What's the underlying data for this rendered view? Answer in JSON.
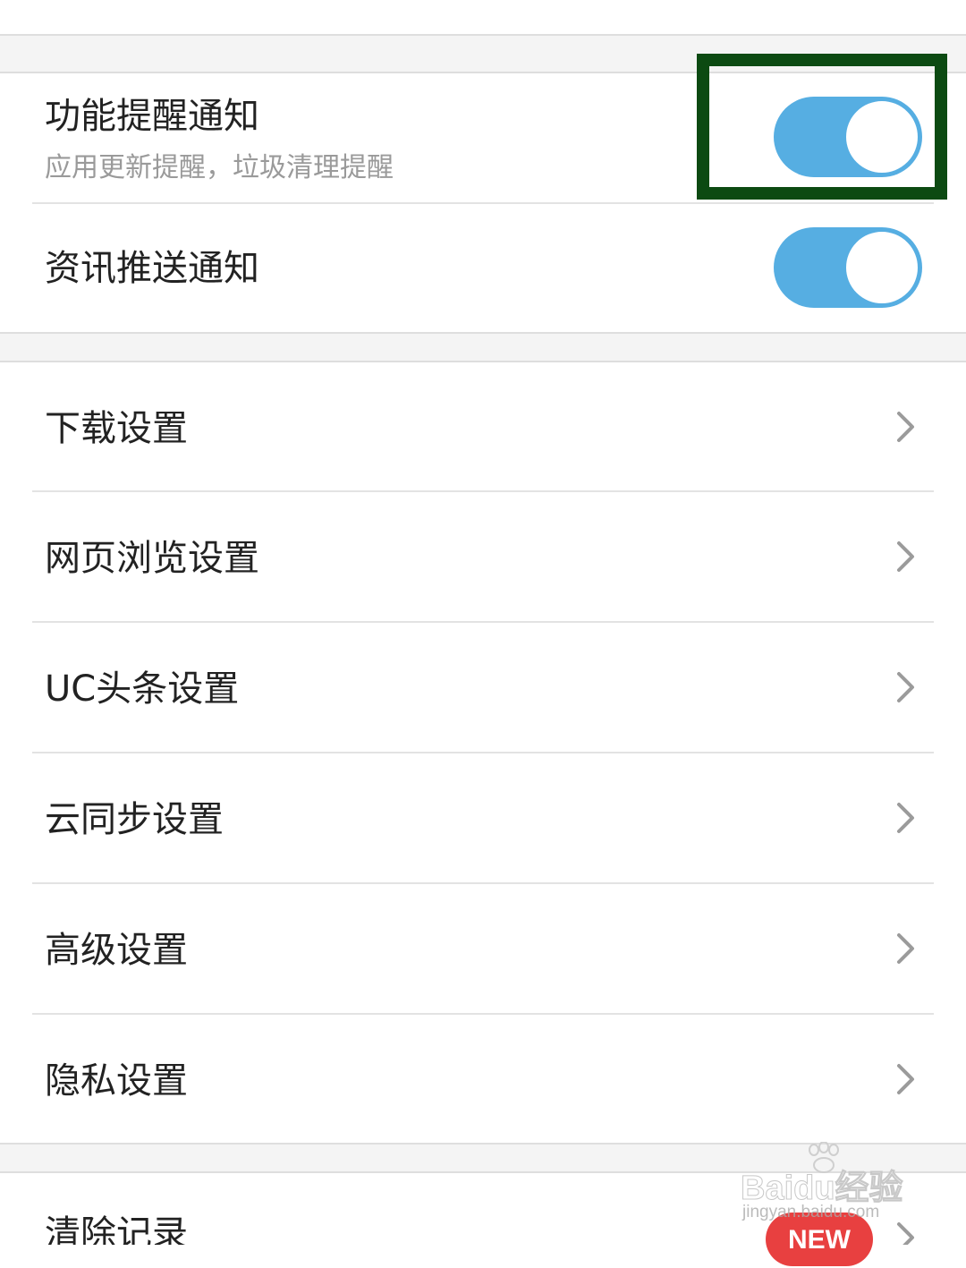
{
  "notifications": {
    "feature": {
      "title": "功能提醒通知",
      "subtitle": "应用更新提醒，垃圾清理提醒",
      "enabled": true
    },
    "news": {
      "title": "资讯推送通知",
      "enabled": true
    }
  },
  "settings_items": [
    {
      "label": "下载设置"
    },
    {
      "label": "网页浏览设置"
    },
    {
      "label": "UC头条设置"
    },
    {
      "label": "云同步设置"
    },
    {
      "label": "高级设置"
    },
    {
      "label": "隐私设置"
    }
  ],
  "bottom": {
    "clear_records_label": "清除记录",
    "badge": "NEW"
  },
  "watermark": {
    "logo": "Baidu经验",
    "url": "jingyan.baidu.com"
  },
  "colors": {
    "toggle_on": "#56aee2",
    "highlight_border": "#0c4a12",
    "badge": "#e84040"
  },
  "icons": {
    "row_arrow": "chevron-right-icon"
  }
}
